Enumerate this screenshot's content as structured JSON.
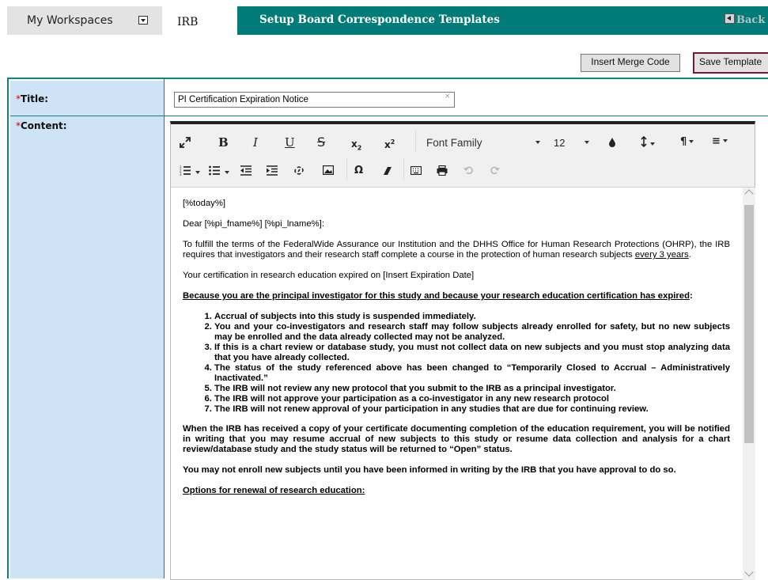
{
  "header": {
    "workspace_menu_label": "My Workspaces",
    "module_label": "IRB",
    "page_title": "Setup Board Correspondence Templates",
    "back_label": "Back"
  },
  "actions": {
    "insert_merge_code": "Insert Merge Code",
    "save_template": "Save Template"
  },
  "form": {
    "title_label": "Title:",
    "content_label": "Content:",
    "required_mark": "*",
    "title_value": "PI Certification Expiration Notice",
    "clear_glyph": "×"
  },
  "editor": {
    "toolbar": {
      "font_family": "Font Family",
      "font_size": "12",
      "row1_icons": [
        "fullscreen-icon",
        "bold-icon",
        "italic-icon",
        "underline-icon",
        "strikethrough-icon",
        "subscript-icon",
        "superscript-icon",
        "font-family-select",
        "font-size-select",
        "text-color-icon",
        "line-height-icon",
        "paragraph-icon",
        "align-icon"
      ],
      "row2_icons": [
        "ordered-list-icon",
        "unordered-list-icon",
        "outdent-icon",
        "indent-icon",
        "link-icon",
        "image-icon",
        "special-char-icon",
        "clear-format-icon",
        "keyboard-icon",
        "print-icon",
        "undo-icon",
        "redo-icon"
      ]
    },
    "content": {
      "p1": "[%today%]",
      "p2": "Dear [%pi_fname%] [%pi_lname%]:",
      "p3_text": "To fulfill the terms of the FederalWide Assurance our Institution and the DHHS Office for Human Research Protections (OHRP), the IRB requires that investigators and their research staff complete a course in the protection of human research subjects ",
      "p3_underlined": "every 3 years",
      "p3_end": ".",
      "p4": "Your certification in research education expired on [Insert Expiration Date]",
      "p5_underlined": "Because you are the principal investigator for this study and because your research education certification has expired",
      "p5_end": ":",
      "list": [
        "Accrual of subjects into this study is suspended immediately.",
        "You and your co-investigators and research staff may follow subjects already enrolled for safety, but no new subjects may be enrolled and the data already collected may not be analyzed.",
        "If this is a chart review or database study, you must not collect data on new subjects and you must stop analyzing data that you have already collected.",
        "The status of the study referenced above has been changed to “Temporarily Closed to Accrual – Administratively Inactivated.”",
        "The IRB will not review any new protocol that you submit to the IRB as a principal investigator.",
        "The IRB will not approve your participation as a co-investigator in any new research protocol",
        "The IRB will not renew approval of your participation in any studies that are due for continuing review."
      ],
      "p6": "When the IRB has received a copy of your certificate documenting completion of the education requirement, you will be notified in writing that you may resume accrual of new subjects to this study or resume data collection and analysis for a chart review/database study and the study status will be returned to “Open” status.",
      "p7": "You may not enroll new subjects until you have been informed in writing by the IRB that you have approval to do so.",
      "p8": "Options for renewal of research education:"
    }
  },
  "colors": {
    "teal": "#007b77",
    "label_column": "#cfe3f6",
    "save_border": "#7a1832",
    "required": "#cc0000"
  }
}
